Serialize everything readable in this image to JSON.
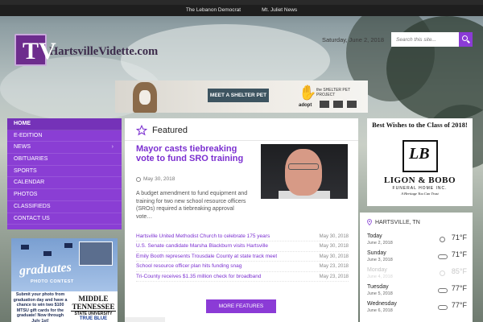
{
  "topbar": {
    "links": [
      "The Lebanon Democrat",
      "Mt. Juliet News"
    ]
  },
  "header": {
    "logo_letters": "TV",
    "logo_text": "HartsvilleVidette.com",
    "date": "Saturday, June 2, 2018",
    "search_placeholder": "Search this site..."
  },
  "ad_banner": {
    "button_label": "MEET A SHELTER PET",
    "project_text": "the SHELTER PET PROJECT",
    "adopt_text": "adopt"
  },
  "nav": {
    "items": [
      {
        "label": "HOME",
        "active": true
      },
      {
        "label": "E-EDITION"
      },
      {
        "label": "NEWS",
        "has_submenu": true
      },
      {
        "label": "OBITUARIES"
      },
      {
        "label": "SPORTS"
      },
      {
        "label": "CALENDAR"
      },
      {
        "label": "PHOTOS"
      },
      {
        "label": "CLASSIFIEDS"
      },
      {
        "label": "CONTACT US"
      }
    ]
  },
  "left_ad": {
    "title": "graduates",
    "subtitle": "PHOTO CONTEST",
    "body": "Submit your photo from graduation day and have a chance to win two $100 MTSU gift cards for the graduate! Now through July 1st!",
    "school_line1": "MIDDLE",
    "school_line2": "TENNESSEE",
    "school_line3": "STATE UNIVERSITY",
    "school_line4": "TRUE BLUE"
  },
  "featured": {
    "heading": "Featured",
    "lead": {
      "title": "Mayor casts tiebreaking vote to fund SRO training",
      "date": "May 30, 2018",
      "summary": "A budget amendment to fund equipment and training for two new school resource officers (SROs) required a tiebreaking approval vote…"
    },
    "headlines": [
      {
        "title": "Hartsville United Methodist Church to celebrate 175 years",
        "date": "May 30, 2018"
      },
      {
        "title": "U.S. Senate candidate Marsha Blackburn visits Hartsville",
        "date": "May 30, 2018"
      },
      {
        "title": "Emily Booth represents Trousdale County at state track meet",
        "date": "May 30, 2018"
      },
      {
        "title": "School resource officer plan hits funding snag",
        "date": "May 23, 2018"
      },
      {
        "title": "Tri-County receives $1.35 million check for broadband",
        "date": "May 23, 2018"
      }
    ],
    "more_label": "MORE FEATURES"
  },
  "right_ad": {
    "title": "Best Wishes to the Class of 2018!",
    "emblem": "LB",
    "name": "LIGON & BOBO",
    "sub": "FUNERAL HOME INC.",
    "tagline": "A Heritage You Can Trust"
  },
  "weather": {
    "location": "HARTSVILLE, TN",
    "days": [
      {
        "day": "Today",
        "date": "June 2, 2018",
        "icon": "sun-icon",
        "temp": "71°F"
      },
      {
        "day": "Sunday",
        "date": "June 3, 2018",
        "icon": "cloud-icon",
        "temp": "71°F"
      },
      {
        "day": "Monday",
        "date": "June 4, 2018",
        "icon": "sun-icon",
        "temp": "85°F",
        "faded": true
      },
      {
        "day": "Tuesday",
        "date": "June 5, 2018",
        "icon": "cloud-icon",
        "temp": "77°F"
      },
      {
        "day": "Wednesday",
        "date": "June 6, 2018",
        "icon": "cloud-icon",
        "temp": "77°F"
      }
    ]
  },
  "colors": {
    "accent": "#8b3bd6",
    "nav_bg": "#8a3ed4",
    "link": "#7b2fd0"
  }
}
